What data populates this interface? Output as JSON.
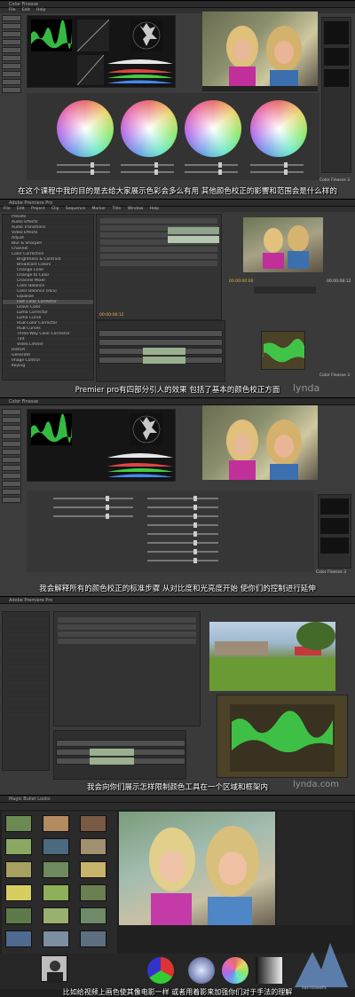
{
  "panel1": {
    "window_title": "Color Finesse",
    "menu": [
      "File",
      "Edit",
      "Help"
    ],
    "brand": "Color Finesse 3",
    "subtitle": "在这个课程中我的目的是去给大家展示色彩会多么有用  其他颜色校正的影響和范围会是什么样的"
  },
  "panel2": {
    "window_title": "Adobe Premiere Pro",
    "menu": [
      "File",
      "Edit",
      "Project",
      "Clip",
      "Sequence",
      "Marker",
      "Title",
      "Window",
      "Help"
    ],
    "timecode_left": "00:00:00:00",
    "timecode_right": "00:00:08:12",
    "timecode_row": "00:00:08:12",
    "brand": "Color Finesse 3",
    "subtitle": "Premier pro有四部分引人的效果  包括了基本的颜色校正方面",
    "watermark": "lynda",
    "effects_list": [
      "Presets",
      "Audio Effects",
      "Audio Transitions",
      "Video Effects",
      "Adjust",
      "Blur & Sharpen",
      "Channel",
      "Color Correction",
      "Brightness & Contrast",
      "Broadcast Colors",
      "Change Color",
      "Change to Color",
      "Channel Mixer",
      "Color Balance",
      "Color Balance (HLS)",
      "Equalize",
      "Fast Color Corrector",
      "Leave Color",
      "Luma Corrector",
      "Luma Curve",
      "RGB Color Corrector",
      "RGB Curves",
      "Three-Way Color Corrector",
      "Tint",
      "Video Limiter",
      "Distort",
      "Generate",
      "Image Control",
      "Keying"
    ]
  },
  "panel3": {
    "window_title": "Color Finesse",
    "brand": "Color Finesse 3",
    "subtitle": "我会解释所有的颜色校正的标准步骤  从对比度和光亮度开始  使你们的控制进行延伸"
  },
  "panel4": {
    "window_title": "Adobe Premiere Pro",
    "subtitle": "我会向你们展示怎样限制颜色工具在一个区域和框架内",
    "watermark": "lynda.com"
  },
  "panel5": {
    "window_title": "Magic Bullet Looks",
    "subtitle": "比如给视频上画色使其像电影一样  或者用着影来加强你们对于手法的理解",
    "watermark": "sacrosawfx"
  },
  "colors": {
    "panel_bg": "#3b3b3b",
    "wave_green": "#39d64b",
    "accent_yellow": "#c8b44a"
  }
}
